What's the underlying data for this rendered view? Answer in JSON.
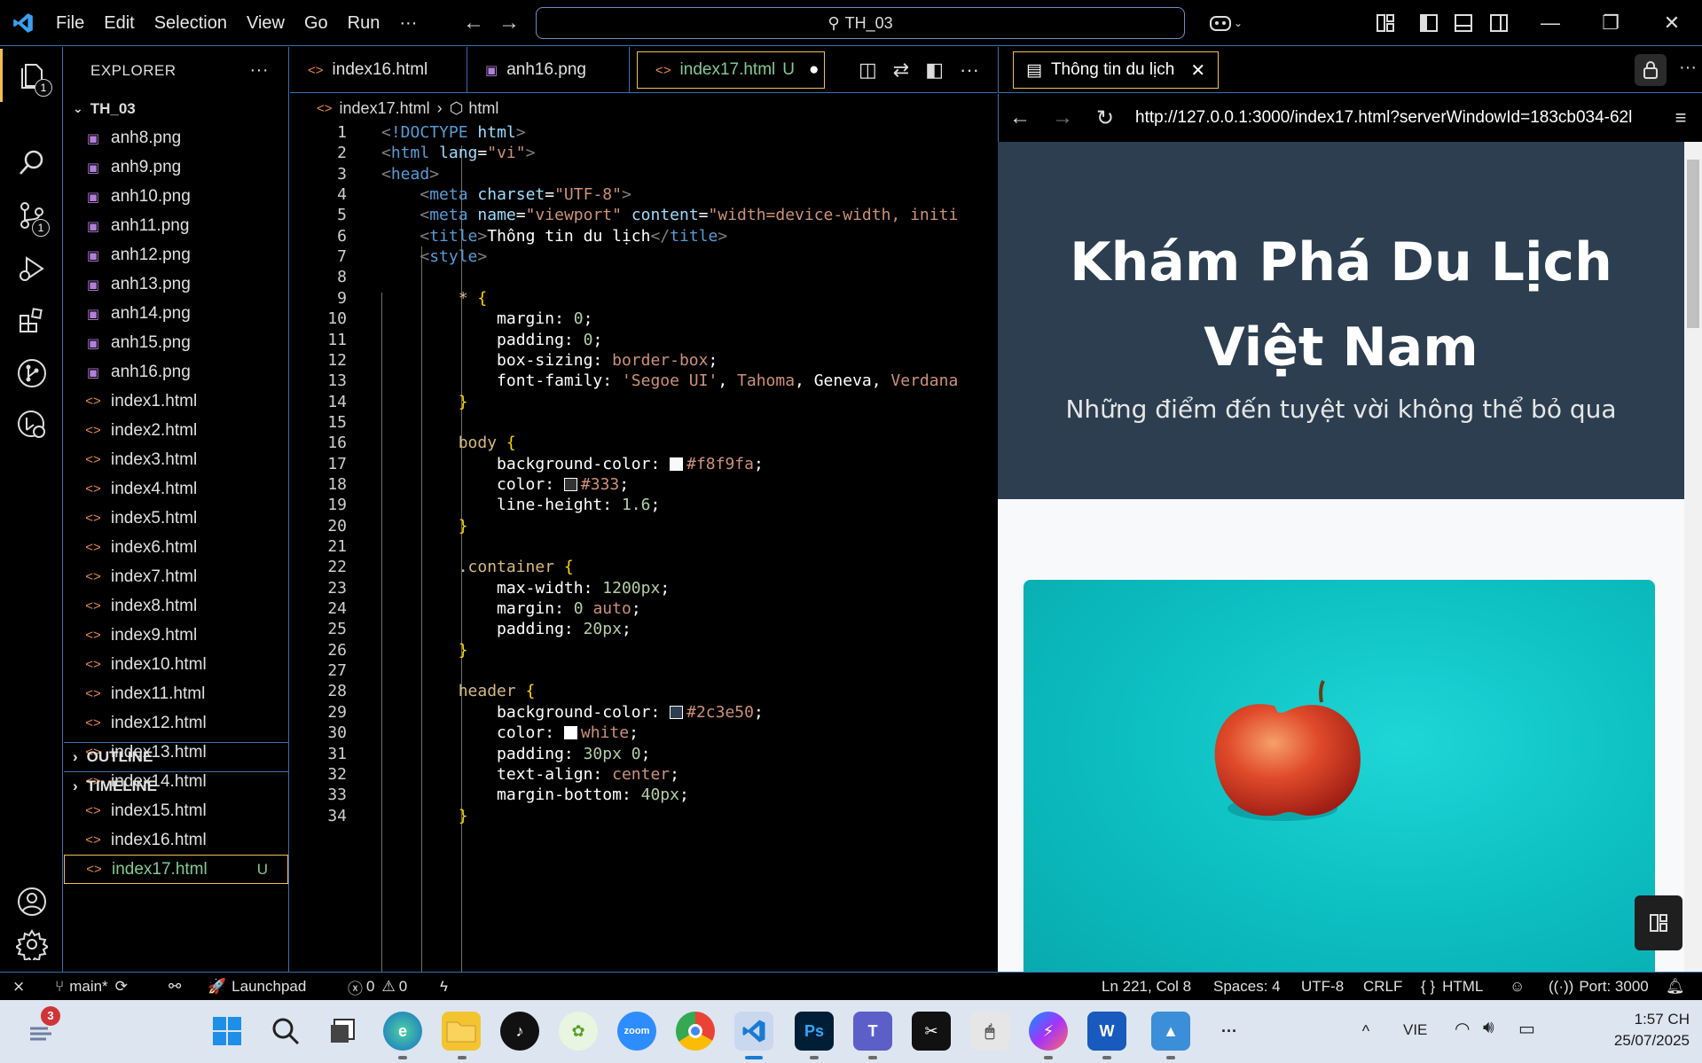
{
  "titlebar": {
    "menu": [
      "File",
      "Edit",
      "Selection",
      "View",
      "Go",
      "Run",
      "···"
    ],
    "search_text": "TH_03"
  },
  "activity_badges": {
    "explorer": "1",
    "scm": "1"
  },
  "explorer": {
    "header": "EXPLORER",
    "more": "···",
    "folder": "TH_03",
    "files": [
      {
        "name": "anh8.png",
        "type": "image"
      },
      {
        "name": "anh9.png",
        "type": "image"
      },
      {
        "name": "anh10.png",
        "type": "image"
      },
      {
        "name": "anh11.png",
        "type": "image"
      },
      {
        "name": "anh12.png",
        "type": "image"
      },
      {
        "name": "anh13.png",
        "type": "image"
      },
      {
        "name": "anh14.png",
        "type": "image"
      },
      {
        "name": "anh15.png",
        "type": "image"
      },
      {
        "name": "anh16.png",
        "type": "image"
      },
      {
        "name": "index1.html",
        "type": "html"
      },
      {
        "name": "index2.html",
        "type": "html"
      },
      {
        "name": "index3.html",
        "type": "html"
      },
      {
        "name": "index4.html",
        "type": "html"
      },
      {
        "name": "index5.html",
        "type": "html"
      },
      {
        "name": "index6.html",
        "type": "html"
      },
      {
        "name": "index7.html",
        "type": "html"
      },
      {
        "name": "index8.html",
        "type": "html"
      },
      {
        "name": "index9.html",
        "type": "html"
      },
      {
        "name": "index10.html",
        "type": "html"
      },
      {
        "name": "index11.html",
        "type": "html"
      },
      {
        "name": "index12.html",
        "type": "html"
      },
      {
        "name": "index13.html",
        "type": "html"
      },
      {
        "name": "index14.html",
        "type": "html"
      },
      {
        "name": "index15.html",
        "type": "html"
      },
      {
        "name": "index16.html",
        "type": "html"
      },
      {
        "name": "index17.html",
        "type": "html",
        "active": true,
        "status": "U"
      }
    ],
    "outline": "OUTLINE",
    "timeline": "TIMELINE"
  },
  "tabs": [
    {
      "label": "index16.html",
      "icon": "html-icon"
    },
    {
      "label": "anh16.png",
      "icon": "image-icon"
    },
    {
      "label": "index17.html",
      "icon": "html-icon",
      "active": true,
      "status": "U",
      "dirty": "●"
    }
  ],
  "breadcrumb": {
    "file": "index17.html",
    "sep": "›",
    "node": "html"
  },
  "code_lines": [
    [
      [
        "tk-bracket",
        "<"
      ],
      [
        "tk-doctype",
        "!DOCTYPE "
      ],
      [
        "tk-attr",
        "html"
      ],
      [
        "tk-bracket",
        ">"
      ]
    ],
    [
      [
        "tk-bracket",
        "<"
      ],
      [
        "tk-tag",
        "html "
      ],
      [
        "tk-attr",
        "lang"
      ],
      [
        "tk-text",
        "="
      ],
      [
        "tk-str",
        "\"vi\""
      ],
      [
        "tk-bracket",
        ">"
      ]
    ],
    [
      [
        "tk-bracket",
        "<"
      ],
      [
        "tk-tag",
        "head"
      ],
      [
        "tk-bracket",
        ">"
      ]
    ],
    [
      [
        "tk-text",
        "    "
      ],
      [
        "tk-bracket",
        "<"
      ],
      [
        "tk-tag",
        "meta "
      ],
      [
        "tk-attr",
        "charset"
      ],
      [
        "tk-text",
        "="
      ],
      [
        "tk-str",
        "\"UTF-8\""
      ],
      [
        "tk-bracket",
        ">"
      ]
    ],
    [
      [
        "tk-text",
        "    "
      ],
      [
        "tk-bracket",
        "<"
      ],
      [
        "tk-tag",
        "meta "
      ],
      [
        "tk-attr",
        "name"
      ],
      [
        "tk-text",
        "="
      ],
      [
        "tk-str",
        "\"viewport\" "
      ],
      [
        "tk-attr",
        "content"
      ],
      [
        "tk-text",
        "="
      ],
      [
        "tk-str",
        "\"width=device-width, initi"
      ]
    ],
    [
      [
        "tk-text",
        "    "
      ],
      [
        "tk-bracket",
        "<"
      ],
      [
        "tk-tag",
        "title"
      ],
      [
        "tk-bracket",
        ">"
      ],
      [
        "tk-text",
        "Thông tin du lịch"
      ],
      [
        "tk-bracket",
        "</"
      ],
      [
        "tk-tag",
        "title"
      ],
      [
        "tk-bracket",
        ">"
      ]
    ],
    [
      [
        "tk-text",
        "    "
      ],
      [
        "tk-bracket",
        "<"
      ],
      [
        "tk-tag",
        "style"
      ],
      [
        "tk-bracket",
        ">"
      ]
    ],
    [],
    [
      [
        "tk-text",
        "        "
      ],
      [
        "tk-sel",
        "* "
      ],
      [
        "tk-brace",
        "{"
      ]
    ],
    [
      [
        "tk-text",
        "            "
      ],
      [
        "tk-prop",
        "margin"
      ],
      [
        "tk-text",
        ": "
      ],
      [
        "tk-num",
        "0"
      ],
      [
        "tk-text",
        ";"
      ]
    ],
    [
      [
        "tk-text",
        "            "
      ],
      [
        "tk-prop",
        "padding"
      ],
      [
        "tk-text",
        ": "
      ],
      [
        "tk-num",
        "0"
      ],
      [
        "tk-text",
        ";"
      ]
    ],
    [
      [
        "tk-text",
        "            "
      ],
      [
        "tk-prop",
        "box-sizing"
      ],
      [
        "tk-text",
        ": "
      ],
      [
        "tk-val",
        "border-box"
      ],
      [
        "tk-text",
        ";"
      ]
    ],
    [
      [
        "tk-text",
        "            "
      ],
      [
        "tk-prop",
        "font-family"
      ],
      [
        "tk-text",
        ": "
      ],
      [
        "tk-str",
        "'Segoe UI'"
      ],
      [
        "tk-text",
        ", "
      ],
      [
        "tk-val",
        "Tahoma"
      ],
      [
        "tk-text",
        ", Geneva, "
      ],
      [
        "tk-val",
        "Verdana"
      ]
    ],
    [
      [
        "tk-text",
        "        "
      ],
      [
        "tk-brace",
        "}"
      ]
    ],
    [],
    [
      [
        "tk-text",
        "        "
      ],
      [
        "tk-sel",
        "body "
      ],
      [
        "tk-brace",
        "{"
      ]
    ],
    [
      [
        "tk-text",
        "            "
      ],
      [
        "tk-prop",
        "background-color"
      ],
      [
        "tk-text",
        ": "
      ],
      [
        "swatch",
        "#f8f9fa"
      ],
      [
        "tk-val",
        "#f8f9fa"
      ],
      [
        "tk-text",
        ";"
      ]
    ],
    [
      [
        "tk-text",
        "            "
      ],
      [
        "tk-prop",
        "color"
      ],
      [
        "tk-text",
        ": "
      ],
      [
        "swatch",
        "#333333"
      ],
      [
        "tk-val",
        "#333"
      ],
      [
        "tk-text",
        ";"
      ]
    ],
    [
      [
        "tk-text",
        "            "
      ],
      [
        "tk-prop",
        "line-height"
      ],
      [
        "tk-text",
        ": "
      ],
      [
        "tk-num",
        "1.6"
      ],
      [
        "tk-text",
        ";"
      ]
    ],
    [
      [
        "tk-text",
        "        "
      ],
      [
        "tk-brace",
        "}"
      ]
    ],
    [],
    [
      [
        "tk-text",
        "        "
      ],
      [
        "tk-sel",
        ".container "
      ],
      [
        "tk-brace",
        "{"
      ]
    ],
    [
      [
        "tk-text",
        "            "
      ],
      [
        "tk-prop",
        "max-width"
      ],
      [
        "tk-text",
        ": "
      ],
      [
        "tk-num",
        "1200px"
      ],
      [
        "tk-text",
        ";"
      ]
    ],
    [
      [
        "tk-text",
        "            "
      ],
      [
        "tk-prop",
        "margin"
      ],
      [
        "tk-text",
        ": "
      ],
      [
        "tk-num",
        "0 "
      ],
      [
        "tk-val",
        "auto"
      ],
      [
        "tk-text",
        ";"
      ]
    ],
    [
      [
        "tk-text",
        "            "
      ],
      [
        "tk-prop",
        "padding"
      ],
      [
        "tk-text",
        ": "
      ],
      [
        "tk-num",
        "20px"
      ],
      [
        "tk-text",
        ";"
      ]
    ],
    [
      [
        "tk-text",
        "        "
      ],
      [
        "tk-brace",
        "}"
      ]
    ],
    [],
    [
      [
        "tk-text",
        "        "
      ],
      [
        "tk-sel",
        "header "
      ],
      [
        "tk-brace",
        "{"
      ]
    ],
    [
      [
        "tk-text",
        "            "
      ],
      [
        "tk-prop",
        "background-color"
      ],
      [
        "tk-text",
        ": "
      ],
      [
        "swatch",
        "#2c3e50"
      ],
      [
        "tk-val",
        "#2c3e50"
      ],
      [
        "tk-text",
        ";"
      ]
    ],
    [
      [
        "tk-text",
        "            "
      ],
      [
        "tk-prop",
        "color"
      ],
      [
        "tk-text",
        ": "
      ],
      [
        "swatch",
        "#ffffff"
      ],
      [
        "tk-val",
        "white"
      ],
      [
        "tk-text",
        ";"
      ]
    ],
    [
      [
        "tk-text",
        "            "
      ],
      [
        "tk-prop",
        "padding"
      ],
      [
        "tk-text",
        ": "
      ],
      [
        "tk-num",
        "30px 0"
      ],
      [
        "tk-text",
        ";"
      ]
    ],
    [
      [
        "tk-text",
        "            "
      ],
      [
        "tk-prop",
        "text-align"
      ],
      [
        "tk-text",
        ": "
      ],
      [
        "tk-val",
        "center"
      ],
      [
        "tk-text",
        ";"
      ]
    ],
    [
      [
        "tk-text",
        "            "
      ],
      [
        "tk-prop",
        "margin-bottom"
      ],
      [
        "tk-text",
        ": "
      ],
      [
        "tk-num",
        "40px"
      ],
      [
        "tk-text",
        ";"
      ]
    ],
    [
      [
        "tk-text",
        "        "
      ],
      [
        "tk-brace",
        "}"
      ]
    ]
  ],
  "preview": {
    "tab_label": "Thông tin du lịch",
    "url": "http://127.0.0.1:3000/index17.html?serverWindowId=183cb034-62l",
    "page_title": "Khám Phá Du Lịch Việt Nam",
    "page_subtitle": "Những điểm đến tuyệt vời không thể bỏ qua"
  },
  "statusbar": {
    "branch": "main*",
    "launchpad": "Launchpad",
    "errors": "0",
    "warnings": "0",
    "position": "Ln 221, Col 8",
    "spaces": "Spaces: 4",
    "encoding": "UTF-8",
    "eol": "CRLF",
    "language": "HTML",
    "port": "Port: 3000"
  },
  "taskbar": {
    "notification_count": "3",
    "lang": "VIE",
    "time": "1:57 CH",
    "date": "25/07/2025"
  },
  "colors": {
    "accent_border": "#3a6fb0",
    "active_tab_border": "#f0c050",
    "header_bg": "#2c3e50",
    "page_bg": "#f8f9fa"
  }
}
